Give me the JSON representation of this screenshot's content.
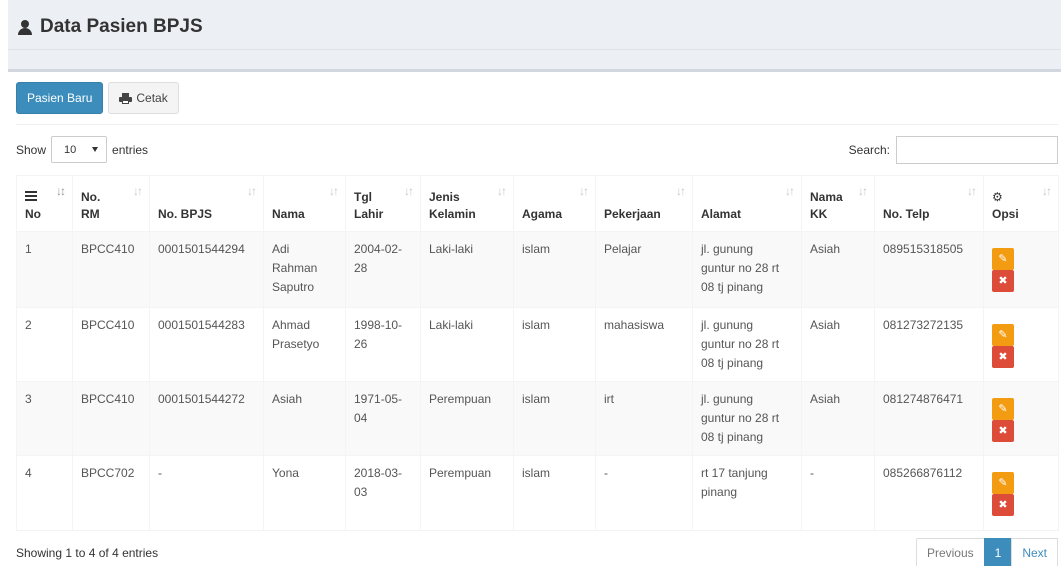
{
  "header": {
    "title": "Data Pasien BPJS"
  },
  "toolbar": {
    "new_label": "Pasien Baru",
    "print_label": "Cetak"
  },
  "length": {
    "show": "Show",
    "value": "10",
    "entries": "entries"
  },
  "search": {
    "label": "Search:",
    "value": ""
  },
  "table": {
    "headers": {
      "no": "No",
      "rm": [
        "No.",
        "RM"
      ],
      "bpjs": "No. BPJS",
      "nama": "Nama",
      "tgl": [
        "Tgl",
        "Lahir"
      ],
      "jk": [
        "Jenis",
        "Kelamin"
      ],
      "agama": "Agama",
      "pekerjaan": "Pekerjaan",
      "alamat": "Alamat",
      "kk": [
        "Nama",
        "KK"
      ],
      "telp": "No. Telp",
      "opsi": "Opsi"
    },
    "rows": [
      {
        "no": "1",
        "rm": "BPCC410",
        "bpjs": "0001501544294",
        "nama": [
          "Adi",
          "Rahman",
          "Saputro"
        ],
        "tgl": [
          "2004-02-",
          "28"
        ],
        "jk": "Laki-laki",
        "agama": "islam",
        "pekerjaan": "Pelajar",
        "alamat": [
          "jl. gunung",
          "guntur no 28 rt",
          "08 tj pinang"
        ],
        "kk": "Asiah",
        "telp": "089515318505"
      },
      {
        "no": "2",
        "rm": "BPCC410",
        "bpjs": "0001501544283",
        "nama": [
          "Ahmad",
          "Prasetyo"
        ],
        "tgl": [
          "1998-10-",
          "26"
        ],
        "jk": "Laki-laki",
        "agama": "islam",
        "pekerjaan": "mahasiswa",
        "alamat": [
          "jl. gunung",
          "guntur no 28 rt",
          "08 tj pinang"
        ],
        "kk": "Asiah",
        "telp": "081273272135"
      },
      {
        "no": "3",
        "rm": "BPCC410",
        "bpjs": "0001501544272",
        "nama": [
          "Asiah"
        ],
        "tgl": [
          "1971-05-",
          "04"
        ],
        "jk": "Perempuan",
        "agama": "islam",
        "pekerjaan": "irt",
        "alamat": [
          "jl. gunung",
          "guntur no 28 rt",
          "08 tj pinang"
        ],
        "kk": "Asiah",
        "telp": "081274876471"
      },
      {
        "no": "4",
        "rm": "BPCC702",
        "bpjs": "-",
        "nama": [
          "Yona"
        ],
        "tgl": [
          "2018-03-",
          "03"
        ],
        "jk": "Perempuan",
        "agama": "islam",
        "pekerjaan": "-",
        "alamat": [
          "rt 17 tanjung",
          "pinang"
        ],
        "kk": "-",
        "telp": "085266876112"
      }
    ]
  },
  "footer": {
    "info": "Showing 1 to 4 of 4 entries"
  },
  "pagination": {
    "previous": "Previous",
    "page": "1",
    "next": "Next"
  },
  "colors": {
    "primary": "#3c8dbc",
    "edit": "#f39c12",
    "delete": "#dd4b39",
    "header_bg": "#ecf0f5"
  },
  "icons": {
    "title": "user-icon",
    "print": "printer-icon",
    "no_col": "list-icon",
    "opsi_col": "gears-icon",
    "edit": "edit-icon",
    "delete": "times-icon",
    "sort": "sort-icon"
  }
}
